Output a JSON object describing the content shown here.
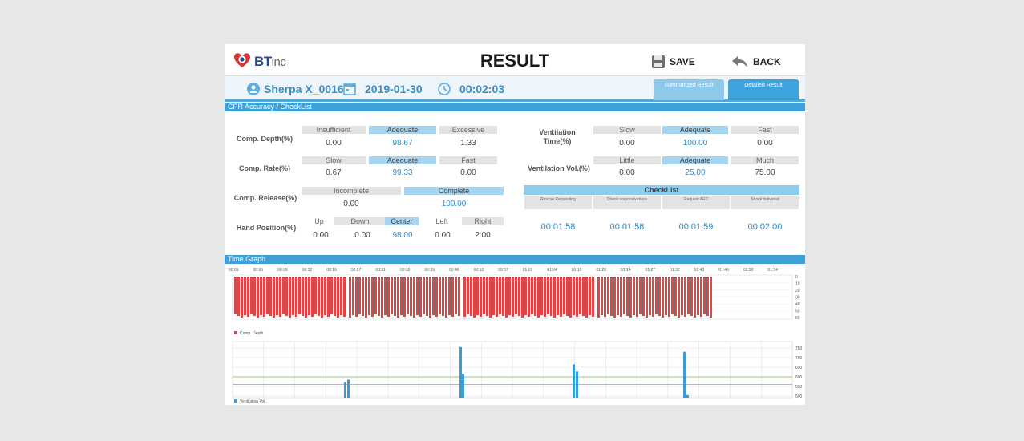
{
  "header": {
    "logo_brand": "BT",
    "logo_suffix": "inc",
    "title": "RESULT",
    "save_label": "SAVE",
    "back_label": "BACK"
  },
  "info": {
    "user": "Sherpa X_0016",
    "date": "2019-01-30",
    "duration": "00:02:03"
  },
  "tabs": [
    {
      "label": "Summarized Result",
      "active": false
    },
    {
      "label": "Detailed Result",
      "active": true
    }
  ],
  "sections": {
    "accuracy": "CPR Accuracy / CheckList",
    "graph": "Time Graph"
  },
  "metrics": {
    "depth": {
      "label": "Comp. Depth(%)",
      "headers": [
        "Insufficient",
        "Adequate",
        "Excessive"
      ],
      "values": [
        "0.00",
        "98.67",
        "1.33"
      ]
    },
    "rate": {
      "label": "Comp. Rate(%)",
      "headers": [
        "Slow",
        "Adequate",
        "Fast"
      ],
      "values": [
        "0.67",
        "99.33",
        "0.00"
      ]
    },
    "release": {
      "label": "Comp. Release(%)",
      "headers": [
        "Incomplete",
        "Complete"
      ],
      "values": [
        "0.00",
        "100.00"
      ]
    },
    "hand": {
      "label": "Hand Position(%)",
      "headers": [
        "Up",
        "Down",
        "Center",
        "Left",
        "Right"
      ],
      "values": [
        "0.00",
        "0.00",
        "98.00",
        "0.00",
        "2.00"
      ]
    },
    "vent_time": {
      "label": "Ventilation Time(%)",
      "headers": [
        "Slow",
        "Adequate",
        "Fast"
      ],
      "values": [
        "0.00",
        "100.00",
        "0.00"
      ]
    },
    "vent_vol": {
      "label": "Ventilation Vol.(%)",
      "headers": [
        "Little",
        "Adequate",
        "Much"
      ],
      "values": [
        "0.00",
        "25.00",
        "75.00"
      ]
    }
  },
  "checklist": {
    "title": "CheckList",
    "items": [
      {
        "label": "Rescue Requesting",
        "time": "00:01:58"
      },
      {
        "label": "Check responsiveness",
        "time": "00:01:58"
      },
      {
        "label": "Request AED",
        "time": "00:01:59"
      },
      {
        "label": "Shock delivered",
        "time": "00:02:00"
      }
    ]
  },
  "colors": {
    "accent": "#3ea0d8",
    "depth_bar": "#d84848",
    "vent_bar": "#3a9bd5",
    "baseline": "#7dbf5a"
  },
  "graph": {
    "time_ticks": [
      "00:01",
      "00:05",
      "00:09",
      "00:12",
      "00:16",
      "00:27",
      "00:31",
      "00:35",
      "00:39",
      "00:46",
      "00:53",
      "00:57",
      "01:01",
      "01:04",
      "01:16",
      "01:20",
      "01:24",
      "01:27",
      "01:32",
      "01:43",
      "01:46",
      "01:50",
      "01:54"
    ],
    "depth_axis": [
      "0",
      "10",
      "20",
      "30",
      "40",
      "50",
      "60"
    ],
    "vent_axis": [
      "750",
      "700",
      "650",
      "600",
      "550",
      "500"
    ],
    "depth_legend": "Comp. Depth",
    "vent_legend": "Ventilation Vol.",
    "depth_segments": [
      [
        0,
        139
      ],
      [
        143,
        283
      ],
      [
        286,
        451
      ],
      [
        453,
        598
      ]
    ],
    "vent_spikes": [
      {
        "pos": 139,
        "value": 572
      },
      {
        "pos": 143,
        "value": 585
      },
      {
        "pos": 283,
        "value": 755
      },
      {
        "pos": 286,
        "value": 615
      },
      {
        "pos": 424,
        "value": 665
      },
      {
        "pos": 428,
        "value": 628
      },
      {
        "pos": 562,
        "value": 730
      },
      {
        "pos": 566,
        "value": 505
      }
    ]
  }
}
